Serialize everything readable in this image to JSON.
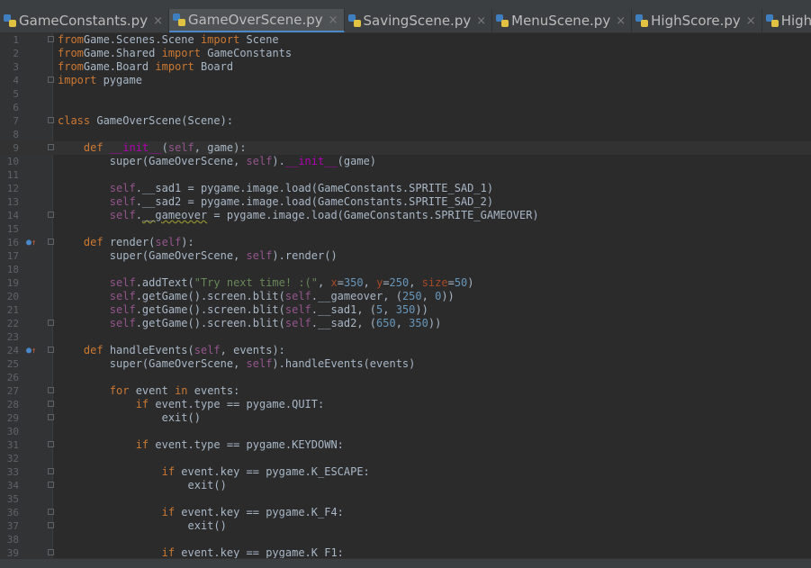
{
  "tabs": [
    {
      "label": "GameConstants.py",
      "active": false
    },
    {
      "label": "GameOverScene.py",
      "active": true
    },
    {
      "label": "SavingScene.py",
      "active": false
    },
    {
      "label": "MenuScene.py",
      "active": false
    },
    {
      "label": "HighScore.py",
      "active": false
    },
    {
      "label": "HighScor",
      "active": false
    }
  ],
  "close_glyph": "×",
  "current_line": 9,
  "code_lines": [
    {
      "n": "1",
      "fold": true,
      "t": [
        [
          "kw",
          "from"
        ],
        [
          "",
          "Game.Scenes.Scene "
        ],
        [
          "kw",
          "import"
        ],
        [
          "",
          " Scene"
        ]
      ]
    },
    {
      "n": "2",
      "t": [
        [
          "kw",
          "from"
        ],
        [
          "",
          "Game.Shared "
        ],
        [
          "kw",
          "import"
        ],
        [
          "",
          " GameConstants"
        ]
      ]
    },
    {
      "n": "3",
      "t": [
        [
          "kw",
          "from"
        ],
        [
          "",
          "Game.Board "
        ],
        [
          "kw",
          "import"
        ],
        [
          "",
          " Board"
        ]
      ]
    },
    {
      "n": "4",
      "fold": true,
      "t": [
        [
          "kw",
          "import"
        ],
        [
          "",
          " pygame"
        ]
      ]
    },
    {
      "n": "5",
      "t": []
    },
    {
      "n": "6",
      "t": []
    },
    {
      "n": "7",
      "fold": true,
      "t": [
        [
          "kw",
          "class"
        ],
        [
          "",
          " GameOverScene(Scene):"
        ]
      ]
    },
    {
      "n": "8",
      "t": []
    },
    {
      "n": "9",
      "fold": true,
      "t": [
        [
          "",
          "    "
        ],
        [
          "kw",
          "def"
        ],
        [
          "",
          " "
        ],
        [
          "mg",
          "__init__"
        ],
        [
          "",
          "("
        ],
        [
          "sf",
          "self"
        ],
        [
          "",
          ", game):"
        ]
      ]
    },
    {
      "n": "10",
      "t": [
        [
          "",
          "        super(GameOverScene, "
        ],
        [
          "sf",
          "self"
        ],
        [
          "",
          ")."
        ],
        [
          "mg",
          "__init__"
        ],
        [
          "",
          "(game)"
        ]
      ]
    },
    {
      "n": "11",
      "t": []
    },
    {
      "n": "12",
      "t": [
        [
          "",
          "        "
        ],
        [
          "sf",
          "self"
        ],
        [
          "",
          ".__sad1 = pygame.image.load(GameConstants.SPRITE_SAD_1)"
        ]
      ]
    },
    {
      "n": "13",
      "t": [
        [
          "",
          "        "
        ],
        [
          "sf",
          "self"
        ],
        [
          "",
          ".__sad2 = pygame.image.load(GameConstants.SPRITE_SAD_2)"
        ]
      ]
    },
    {
      "n": "14",
      "fold": true,
      "t": [
        [
          "",
          "        "
        ],
        [
          "sf",
          "self"
        ],
        [
          "",
          "."
        ],
        [
          "wv",
          "__gameover"
        ],
        [
          "",
          " = pygame.image.load(GameConstants.SPRITE_GAMEOVER)"
        ]
      ]
    },
    {
      "n": "15",
      "t": []
    },
    {
      "n": "16",
      "mark": true,
      "fold": true,
      "t": [
        [
          "",
          "    "
        ],
        [
          "kw",
          "def"
        ],
        [
          "",
          " render("
        ],
        [
          "sf",
          "self"
        ],
        [
          "",
          "):"
        ]
      ]
    },
    {
      "n": "17",
      "t": [
        [
          "",
          "        super(GameOverScene, "
        ],
        [
          "sf",
          "self"
        ],
        [
          "",
          ").render()"
        ]
      ]
    },
    {
      "n": "18",
      "t": []
    },
    {
      "n": "19",
      "t": [
        [
          "",
          "        "
        ],
        [
          "sf",
          "self"
        ],
        [
          "",
          ".addText("
        ],
        [
          "st",
          "\"Try next time! :(\""
        ],
        [
          "",
          ", "
        ],
        [
          "pr",
          "x"
        ],
        [
          "",
          "="
        ],
        [
          "nm",
          "350"
        ],
        [
          "",
          ", "
        ],
        [
          "pr",
          "y"
        ],
        [
          "",
          "="
        ],
        [
          "nm",
          "250"
        ],
        [
          "",
          ", "
        ],
        [
          "pr",
          "size"
        ],
        [
          "",
          "="
        ],
        [
          "nm",
          "50"
        ],
        [
          "",
          ")"
        ]
      ]
    },
    {
      "n": "20",
      "t": [
        [
          "",
          "        "
        ],
        [
          "sf",
          "self"
        ],
        [
          "",
          ".getGame().screen.blit("
        ],
        [
          "sf",
          "self"
        ],
        [
          "",
          ".__gameover, ("
        ],
        [
          "nm",
          "250"
        ],
        [
          "",
          ", "
        ],
        [
          "nm",
          "0"
        ],
        [
          "",
          "))"
        ]
      ]
    },
    {
      "n": "21",
      "t": [
        [
          "",
          "        "
        ],
        [
          "sf",
          "self"
        ],
        [
          "",
          ".getGame().screen.blit("
        ],
        [
          "sf",
          "self"
        ],
        [
          "",
          ".__sad1, ("
        ],
        [
          "nm",
          "5"
        ],
        [
          "",
          ", "
        ],
        [
          "nm",
          "350"
        ],
        [
          "",
          "))"
        ]
      ]
    },
    {
      "n": "22",
      "fold": true,
      "t": [
        [
          "",
          "        "
        ],
        [
          "sf",
          "self"
        ],
        [
          "",
          ".getGame().screen.blit("
        ],
        [
          "sf",
          "self"
        ],
        [
          "",
          ".__sad2, ("
        ],
        [
          "nm",
          "650"
        ],
        [
          "",
          ", "
        ],
        [
          "nm",
          "350"
        ],
        [
          "",
          "))"
        ]
      ]
    },
    {
      "n": "23",
      "t": []
    },
    {
      "n": "24",
      "mark": true,
      "fold": true,
      "t": [
        [
          "",
          "    "
        ],
        [
          "kw",
          "def"
        ],
        [
          "",
          " handleEvents("
        ],
        [
          "sf",
          "self"
        ],
        [
          "",
          ", events):"
        ]
      ]
    },
    {
      "n": "25",
      "t": [
        [
          "",
          "        super(GameOverScene, "
        ],
        [
          "sf",
          "self"
        ],
        [
          "",
          ").handleEvents(events)"
        ]
      ]
    },
    {
      "n": "26",
      "t": []
    },
    {
      "n": "27",
      "fold": true,
      "t": [
        [
          "",
          "        "
        ],
        [
          "kw",
          "for"
        ],
        [
          "",
          " event "
        ],
        [
          "kw",
          "in"
        ],
        [
          "",
          " events:"
        ]
      ]
    },
    {
      "n": "28",
      "fold": true,
      "t": [
        [
          "",
          "            "
        ],
        [
          "kw",
          "if"
        ],
        [
          "",
          " event.type == pygame.QUIT:"
        ]
      ]
    },
    {
      "n": "29",
      "fold": true,
      "t": [
        [
          "",
          "                exit()"
        ]
      ]
    },
    {
      "n": "30",
      "t": []
    },
    {
      "n": "31",
      "fold": true,
      "t": [
        [
          "",
          "            "
        ],
        [
          "kw",
          "if"
        ],
        [
          "",
          " event.type == pygame.KEYDOWN:"
        ]
      ]
    },
    {
      "n": "32",
      "t": []
    },
    {
      "n": "33",
      "fold": true,
      "t": [
        [
          "",
          "                "
        ],
        [
          "kw",
          "if"
        ],
        [
          "",
          " event.key == pygame.K_ESCAPE:"
        ]
      ]
    },
    {
      "n": "34",
      "fold": true,
      "t": [
        [
          "",
          "                    exit()"
        ]
      ]
    },
    {
      "n": "35",
      "t": []
    },
    {
      "n": "36",
      "fold": true,
      "t": [
        [
          "",
          "                "
        ],
        [
          "kw",
          "if"
        ],
        [
          "",
          " event.key == pygame.K_F4:"
        ]
      ]
    },
    {
      "n": "37",
      "fold": true,
      "t": [
        [
          "",
          "                    exit()"
        ]
      ]
    },
    {
      "n": "38",
      "t": []
    },
    {
      "n": "39",
      "fold": true,
      "t": [
        [
          "",
          "                "
        ],
        [
          "kw",
          "if"
        ],
        [
          "",
          " event.key == pygame.K_F1:"
        ]
      ]
    }
  ]
}
